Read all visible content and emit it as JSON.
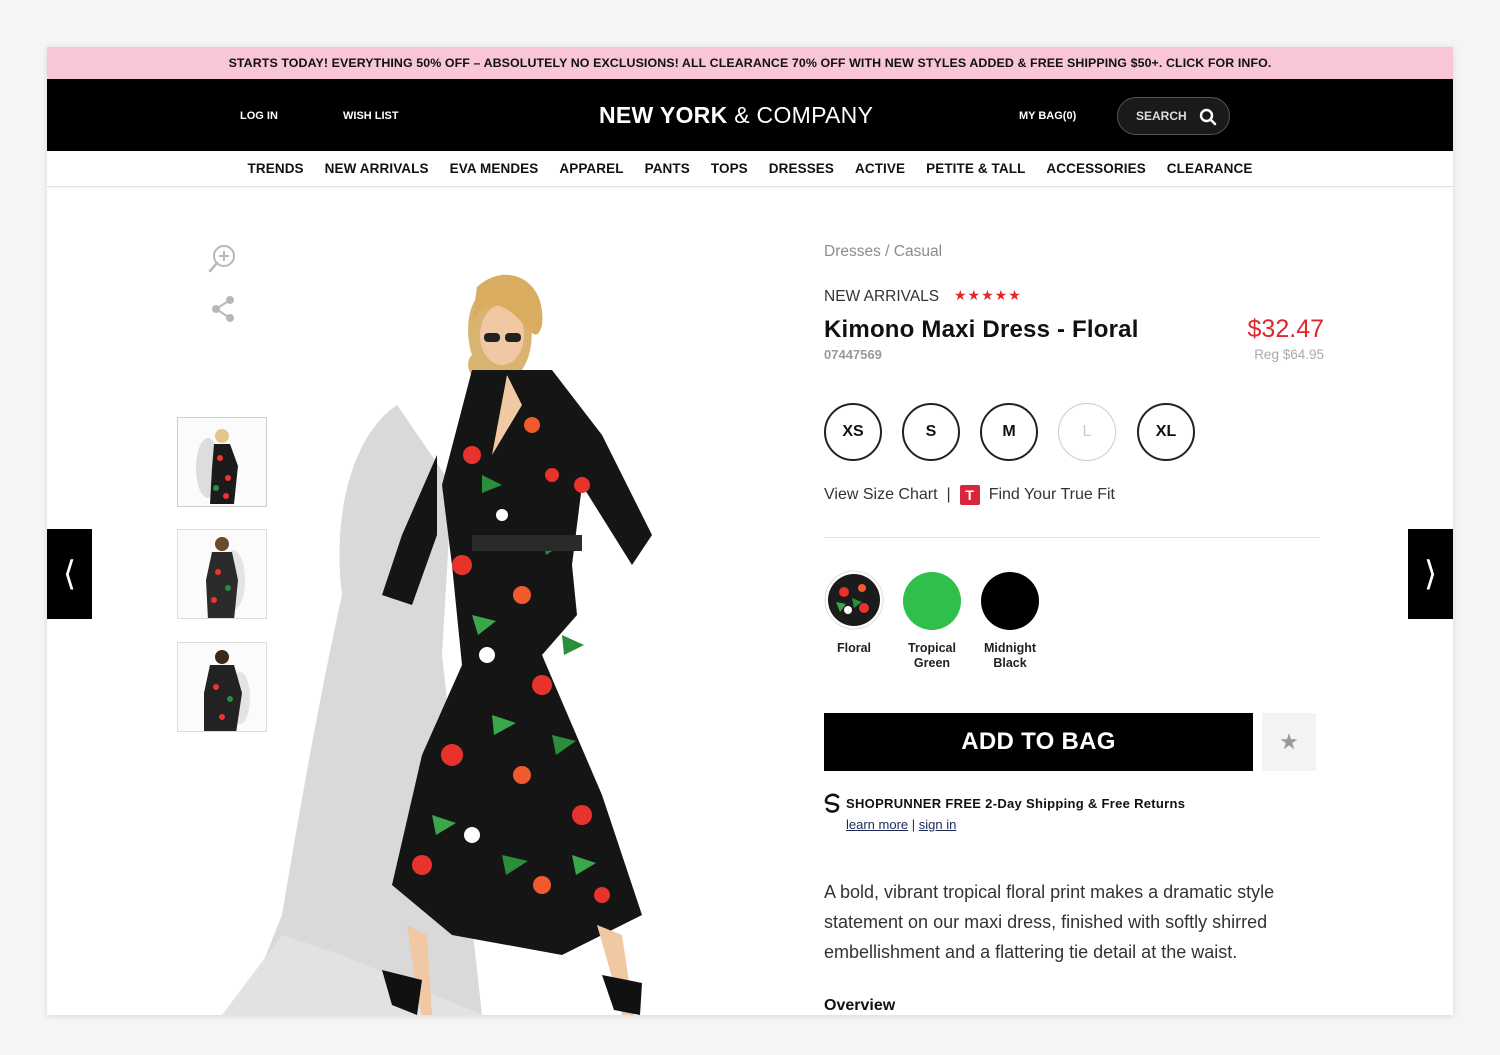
{
  "promo": "STARTS TODAY! EVERYTHING 50% OFF – ABSOLUTELY NO EXCLUSIONS! ALL CLEARANCE 70% OFF WITH NEW STYLES ADDED & FREE SHIPPING $50+. CLICK FOR INFO.",
  "header": {
    "login": "LOG IN",
    "wishlist": "WISH LIST",
    "logo_bold": "NEW YORK",
    "logo_amp": "&",
    "logo_rest": "COMPANY",
    "bag": "MY BAG(0)",
    "search": "SEARCH"
  },
  "nav": [
    "TRENDS",
    "NEW ARRIVALS",
    "EVA MENDES",
    "APPAREL",
    "PANTS",
    "TOPS",
    "DRESSES",
    "ACTIVE",
    "PETITE & TALL",
    "ACCESSORIES",
    "CLEARANCE"
  ],
  "product": {
    "breadcrumb": "Dresses / Casual",
    "collection": "NEW ARRIVALS",
    "rating": 4.5,
    "rating_stars": "★★★★★",
    "name": "Kimono Maxi Dress - Floral",
    "sku": "07447569",
    "price": "$32.47",
    "reg_price": "Reg $64.95",
    "sizes": [
      {
        "label": "XS",
        "available": true
      },
      {
        "label": "S",
        "available": true
      },
      {
        "label": "M",
        "available": true
      },
      {
        "label": "L",
        "available": false
      },
      {
        "label": "XL",
        "available": true
      }
    ],
    "size_chart": "View Size Chart",
    "size_sep": "|",
    "true_fit_icon": "T",
    "true_fit": "Find Your True Fit",
    "colors": [
      {
        "name": "Floral",
        "swatch": "#1b1b1b"
      },
      {
        "name": "Tropical Green",
        "swatch": "#2fbf4a"
      },
      {
        "name": "Midnight Black",
        "swatch": "#000000"
      }
    ],
    "add_to_bag": "ADD TO BAG",
    "shoprunner_brand": "SHOPRUNNER",
    "shoprunner_text": "FREE 2-Day Shipping & Free Returns",
    "learn_more": "learn more",
    "link_sep": "|",
    "sign_in": "sign in",
    "description": "A bold, vibrant tropical floral print makes a dramatic style statement on our maxi dress, finished with softly shirred embellishment and a flattering tie detail at the waist.",
    "overview": "Overview"
  },
  "gallery": {
    "prev": "⟨",
    "next": "⟩",
    "thumbnail_count": 3
  },
  "colors": {
    "promo_bg": "#f9c6d6",
    "header_bg": "#000000",
    "accent_red": "#e3262b",
    "star_red": "#e3262b"
  }
}
